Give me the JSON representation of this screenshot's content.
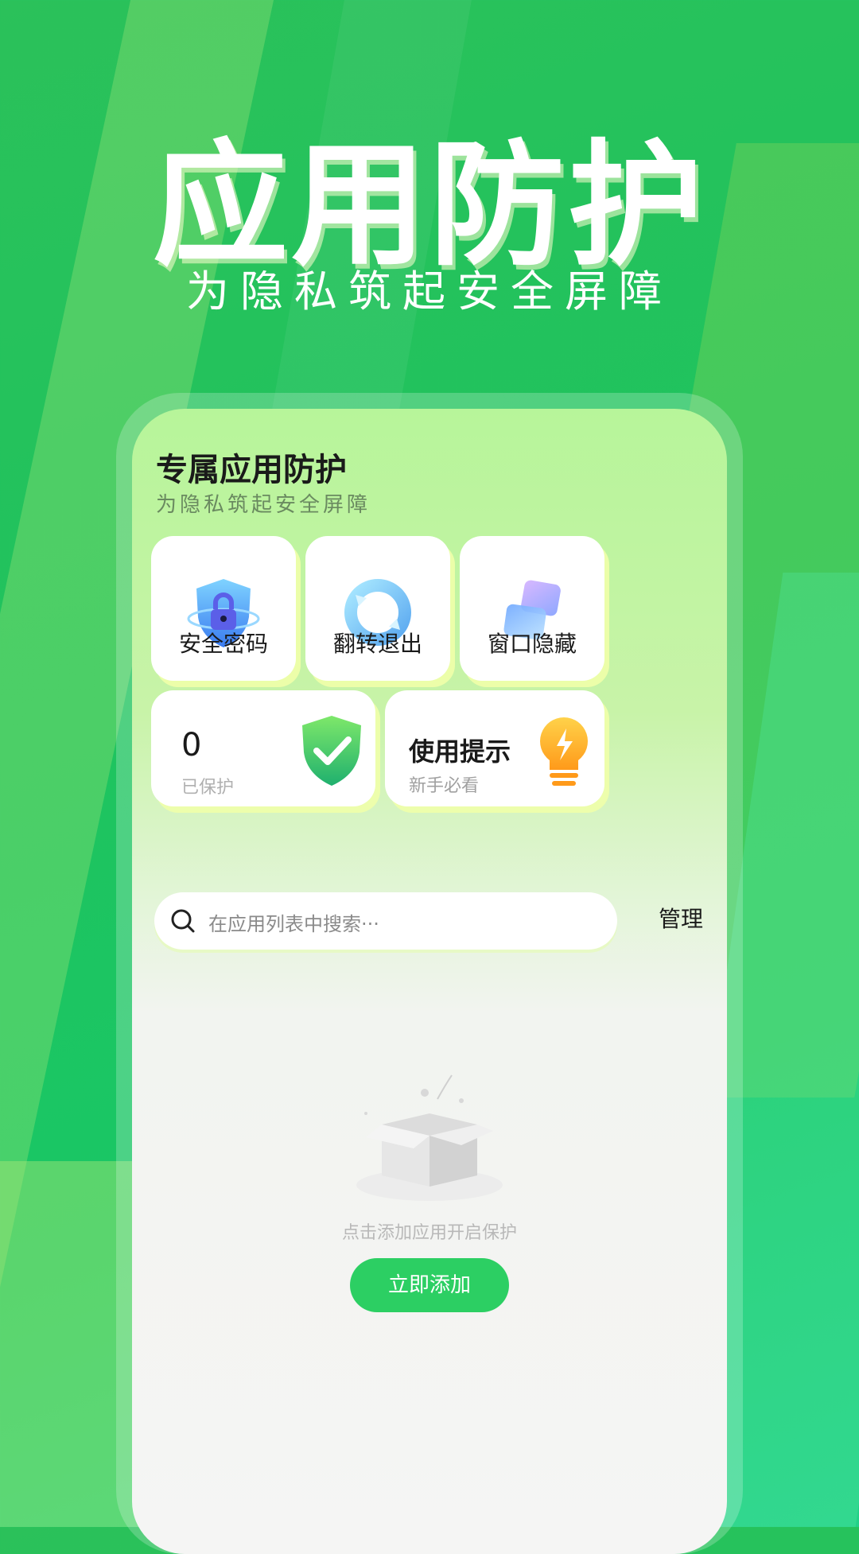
{
  "hero": {
    "title": "应用防护",
    "subtitle": "为隐私筑起安全屏障"
  },
  "card": {
    "title": "专属应用防护",
    "subtitle": "为隐私筑起安全屏障"
  },
  "features": [
    {
      "label": "安全密码",
      "icon": "lock-shield-icon"
    },
    {
      "label": "翻转退出",
      "icon": "flip-ring-icon"
    },
    {
      "label": "窗口隐藏",
      "icon": "window-hide-icon"
    }
  ],
  "protected": {
    "count": "0",
    "label": "已保护",
    "icon": "check-shield-icon"
  },
  "tips": {
    "title": "使用提示",
    "subtitle": "新手必看",
    "icon": "lightbulb-icon"
  },
  "search": {
    "placeholder": "在应用列表中搜索···",
    "manage_label": "管理"
  },
  "empty": {
    "text": "点击添加应用开启保护",
    "button": "立即添加",
    "icon": "empty-box-icon"
  },
  "colors": {
    "accent": "#2ccf63",
    "background": "#1fc35e"
  }
}
